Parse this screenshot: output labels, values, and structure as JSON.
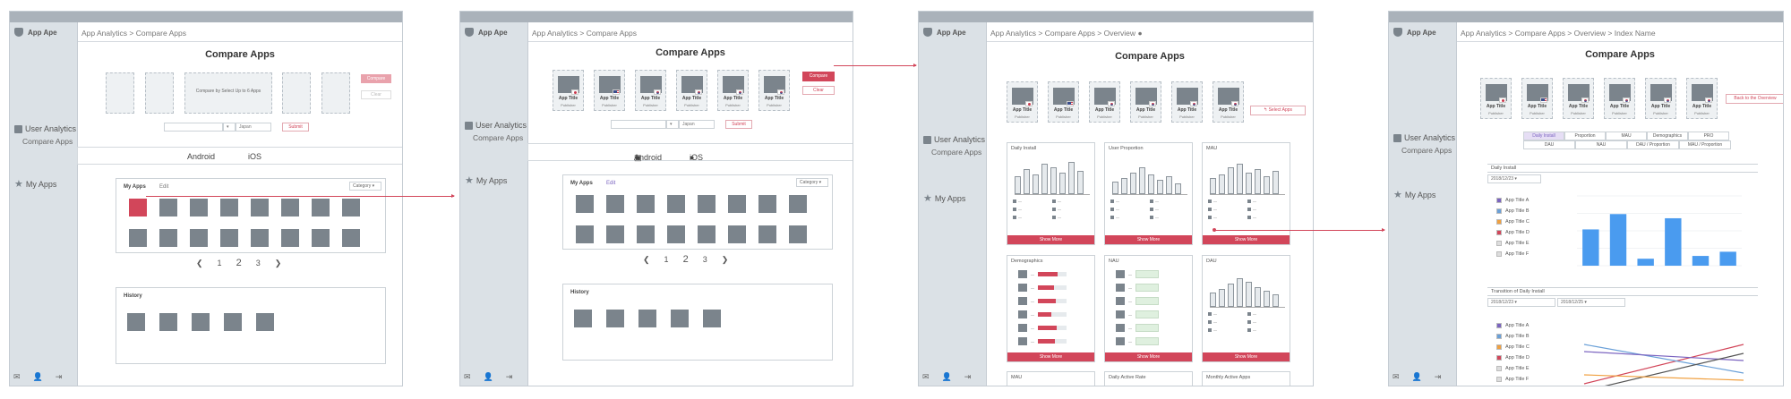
{
  "sidebar": {
    "brand": "App Ape",
    "user_analytics": "User Analytics",
    "compare_apps": "Compare Apps",
    "my_apps": "My Apps",
    "footer_icons": [
      "mail-icon",
      "user-icon",
      "logout-icon"
    ]
  },
  "s1": {
    "crumb": "App Analytics > Compare Apps",
    "title": "Compare Apps",
    "hint": "Compare by Select Up to 6 Apps",
    "compare": "Compare",
    "clear": "Clear",
    "country": "Japan",
    "submit": "Submit",
    "android": "Android",
    "ios": "iOS",
    "myapps": "My Apps",
    "edit": "Edit",
    "category": "Category",
    "pages": [
      "1",
      "2",
      "3"
    ],
    "history": "History"
  },
  "s2": {
    "crumb": "App Analytics > Compare Apps",
    "title": "Compare Apps",
    "app_title": "App Title",
    "publisher": "Publisher",
    "compare": "Compare",
    "clear": "Clear",
    "country": "Japan",
    "submit": "Submit",
    "android": "Android",
    "ios": "iOS",
    "myapps": "My Apps",
    "edit": "Edit",
    "category": "Category",
    "pages": [
      "1",
      "2",
      "3"
    ],
    "history": "History"
  },
  "s3": {
    "crumb": "App Analytics > Compare Apps > Overview",
    "title": "Compare Apps",
    "select_apps": "Select Apps",
    "cards": {
      "daily_install": "Daily Install",
      "user_proportion": "User Proportion",
      "mau": "MAU",
      "demographics": "Demographics",
      "nau": "NAU",
      "dau": "DAU",
      "mau2": "MAU",
      "daily_active_rate": "Daily Active Rate",
      "monthly_active_apps": "Monthly Active Apps"
    },
    "show_more": "Show More"
  },
  "s4": {
    "crumb": "App Analytics > Compare Apps > Overview > Index Name",
    "title": "Compare Apps",
    "back": "Back to the Overview",
    "tabs_row1": [
      "Daily Install",
      "Proportion",
      "MAU",
      "Demographics"
    ],
    "tabs_row1_extra": "PRO",
    "tabs_row2": [
      "DAU",
      "NAU",
      "DAU / Proportion",
      "MAU / Proportion"
    ],
    "panel1": "Daily Install",
    "date1": "2018/12/23",
    "panel2": "Transition of Daily Install",
    "date2a": "2018/12/23",
    "date2b": "2018/12/25",
    "legend": [
      "App Title A",
      "App Title B",
      "App Title C",
      "App Title D",
      "App Title E",
      "App Title F"
    ],
    "legend_colors": [
      "#7b64c0",
      "#6aa0d8",
      "#f0a040",
      "#d2465a",
      "#dddddd",
      "#dddddd"
    ]
  },
  "chart_data": {
    "type": "bar",
    "categories": [
      "App Title A",
      "App Title B",
      "App Title C",
      "App Title D",
      "App Title E",
      "App Title F"
    ],
    "values": [
      52,
      74,
      10,
      68,
      14,
      20
    ],
    "ylim": [
      0,
      100
    ],
    "grid": true
  }
}
